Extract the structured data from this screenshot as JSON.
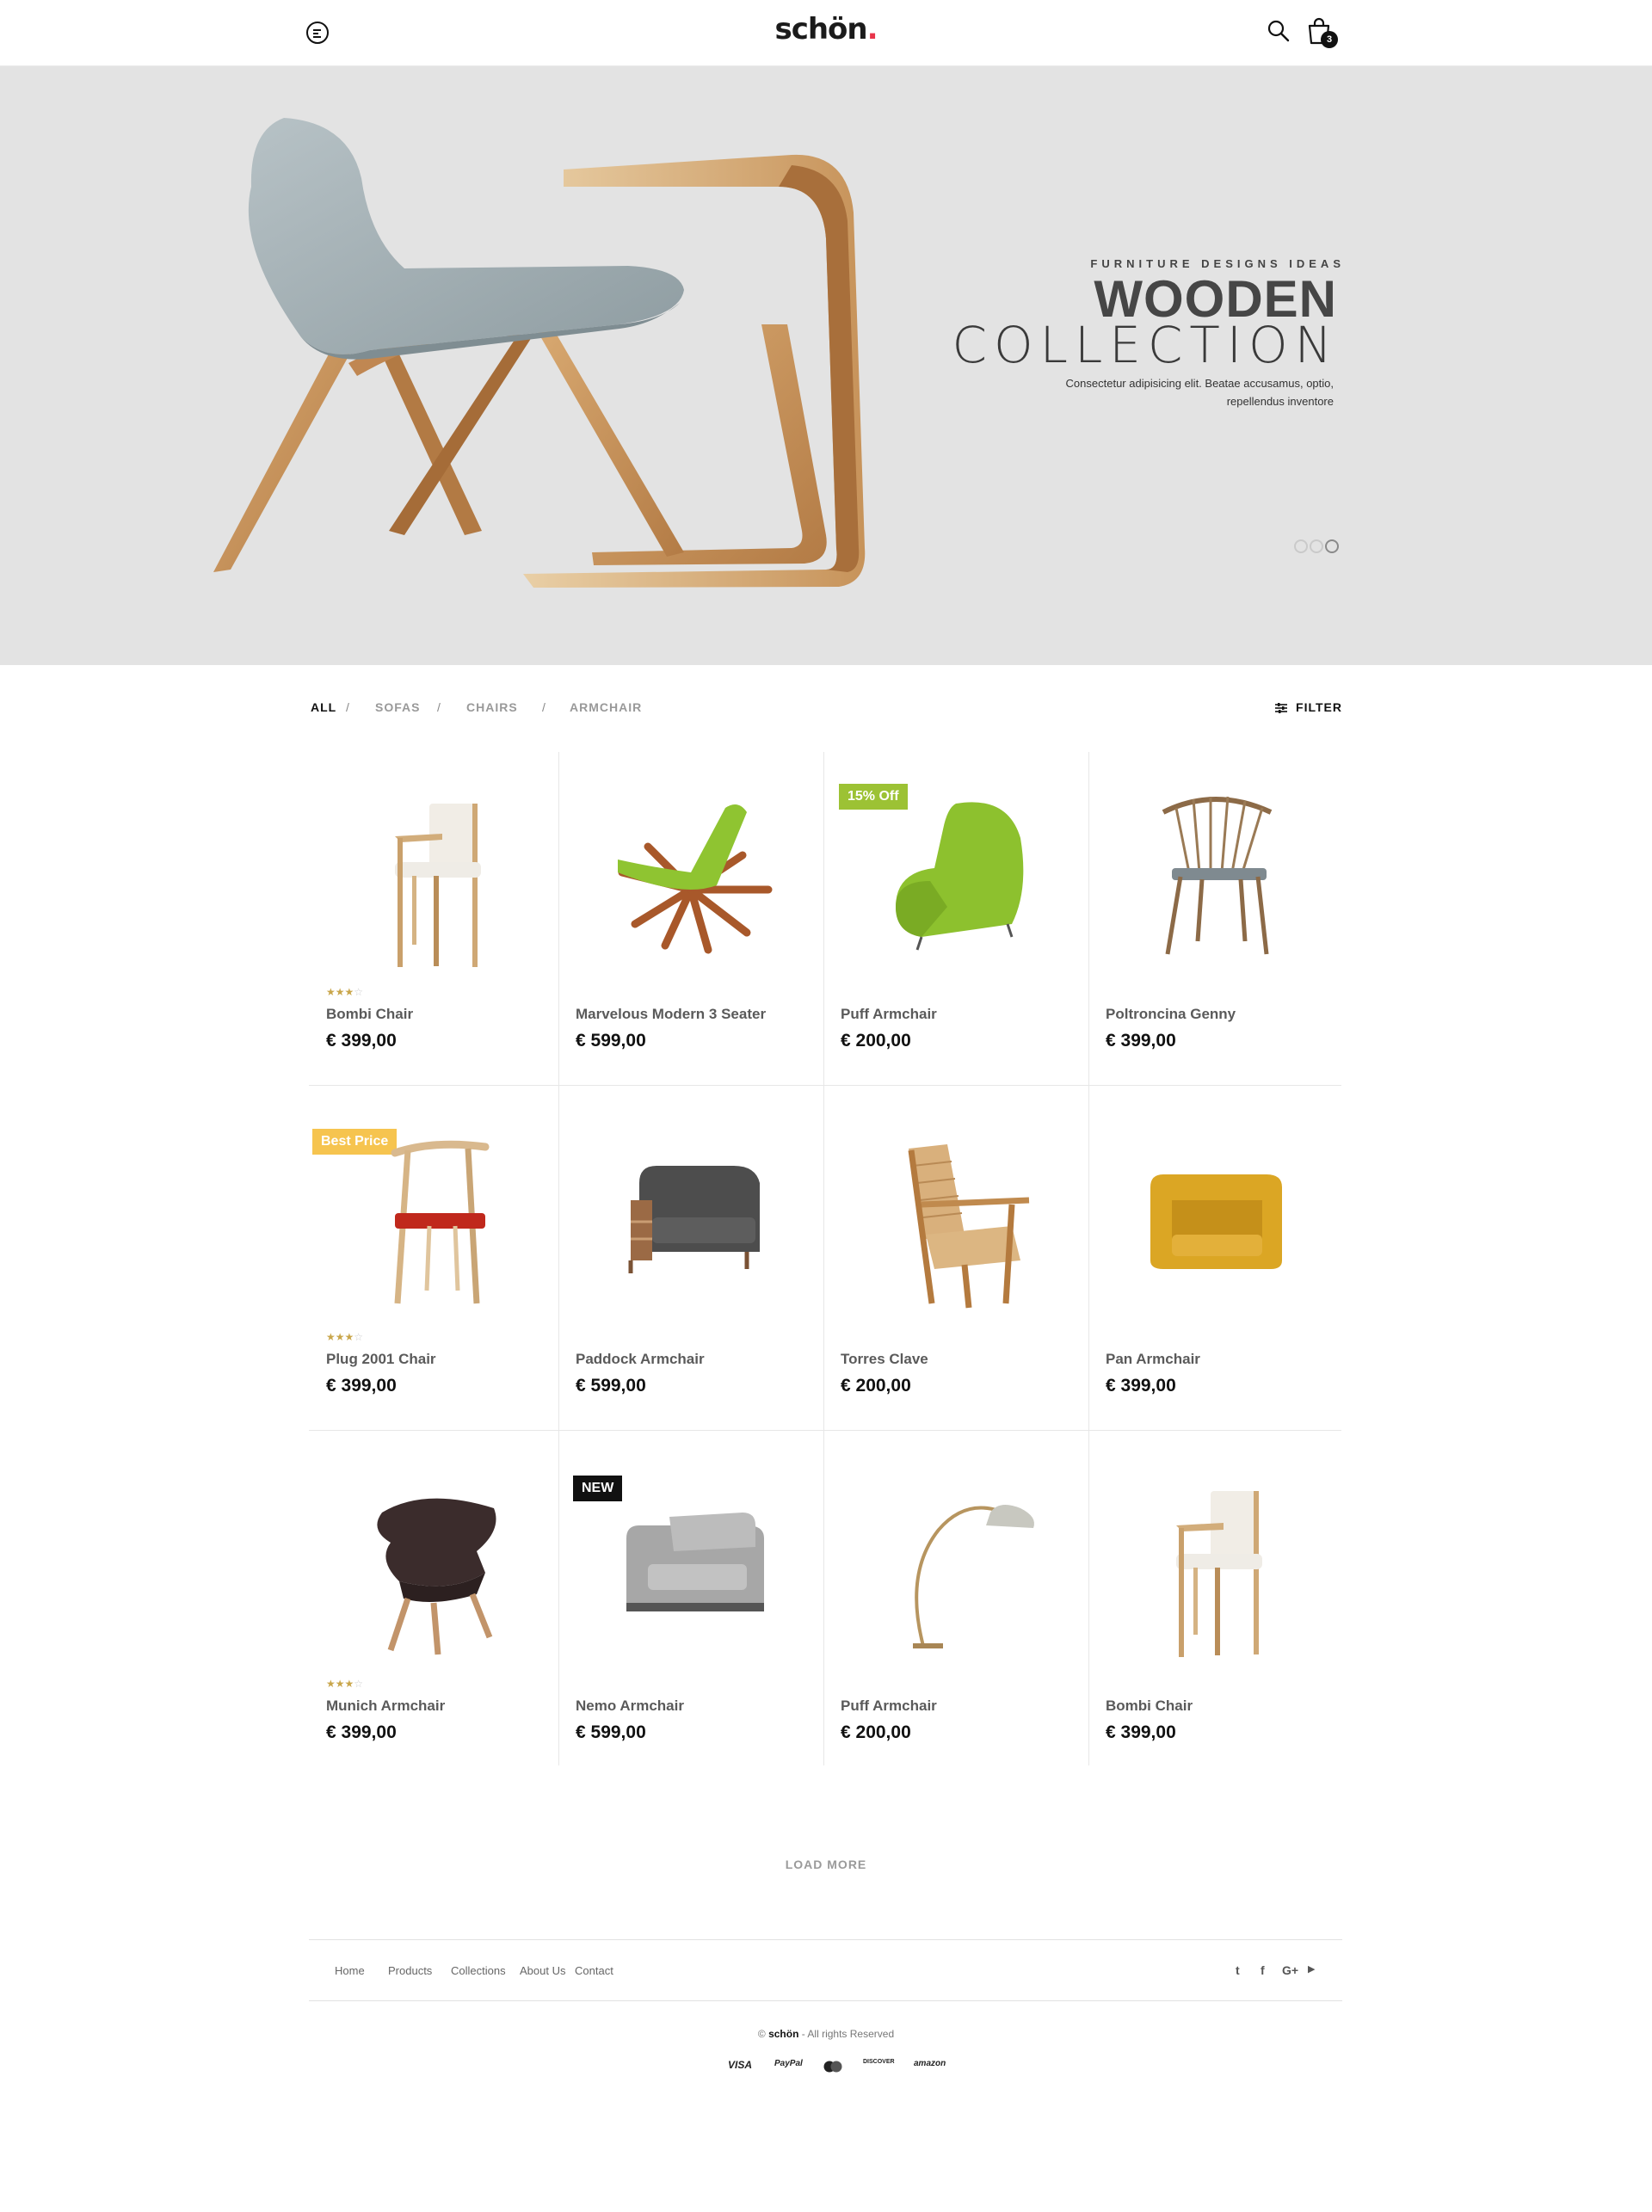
{
  "header": {
    "logo": "schön",
    "logo_dot": ".",
    "cart_count": "3",
    "icons": [
      "menu-icon",
      "search-icon",
      "shopping-bag-icon"
    ]
  },
  "hero": {
    "kicker": "FURNITURE DESIGNS IDEAS",
    "title_line1": "WOODEN",
    "title_line2": "COLLECTION",
    "description": "Consectetur adipisicing elit. Beatae accusamus, optio, repellendus inventore",
    "slides_total": 3,
    "active_slide": 3
  },
  "categories": {
    "items": [
      "ALL",
      "SOFAS",
      "CHAIRS",
      "ARMCHAIR"
    ],
    "separator": "/",
    "active": "ALL",
    "filter_label": "FILTER"
  },
  "products": [
    {
      "name": "Bombi Chair",
      "price": "€ 399,00",
      "rating": 3,
      "badge": ""
    },
    {
      "name": "Marvelous Modern 3 Seater",
      "price": "€ 599,00",
      "rating": null,
      "badge": ""
    },
    {
      "name": "Puff  Armchair",
      "price": "€ 200,00",
      "rating": null,
      "badge": "15% Off"
    },
    {
      "name": "Poltroncina Genny",
      "price": "€ 399,00",
      "rating": null,
      "badge": ""
    },
    {
      "name": "Plug 2001 Chair",
      "price": "€ 399,00",
      "rating": 3,
      "badge": "Best Price"
    },
    {
      "name": "Paddock Armchair",
      "price": "€ 599,00",
      "rating": null,
      "badge": ""
    },
    {
      "name": "Torres Clave",
      "price": "€ 200,00",
      "rating": null,
      "badge": ""
    },
    {
      "name": "Pan Armchair",
      "price": "€ 399,00",
      "rating": null,
      "badge": ""
    },
    {
      "name": "Munich Armchair",
      "price": "€ 399,00",
      "rating": 3,
      "badge": ""
    },
    {
      "name": "Nemo Armchair",
      "price": "€ 599,00",
      "rating": null,
      "badge": "NEW"
    },
    {
      "name": "Puff  Armchair",
      "price": "€ 200,00",
      "rating": null,
      "badge": ""
    },
    {
      "name": "Bombi Chair",
      "price": "€ 399,00",
      "rating": null,
      "badge": ""
    }
  ],
  "load_more": "LOAD MORE",
  "footer": {
    "nav": [
      "Home",
      "Products",
      "Collections",
      "About Us",
      "Contact"
    ],
    "social": [
      "twitter-icon",
      "facebook-icon",
      "google-plus-icon",
      "youtube-icon"
    ],
    "social_glyphs": [
      "t",
      "f",
      "G+",
      "▶"
    ],
    "copyright_prefix": "© ",
    "copyright_brand": "schön",
    "copyright_suffix": " - All rights Reserved",
    "payments": [
      "VISA",
      "PayPal",
      "MasterCard",
      "DISCOVER",
      "amazon"
    ]
  },
  "colors": {
    "accent_red": "#e8344a",
    "badge_green": "#9cc234",
    "badge_yellow": "#f6c44f",
    "badge_black": "#111111",
    "star": "#c9a64b",
    "hero_bg": "#e3e3e3"
  }
}
